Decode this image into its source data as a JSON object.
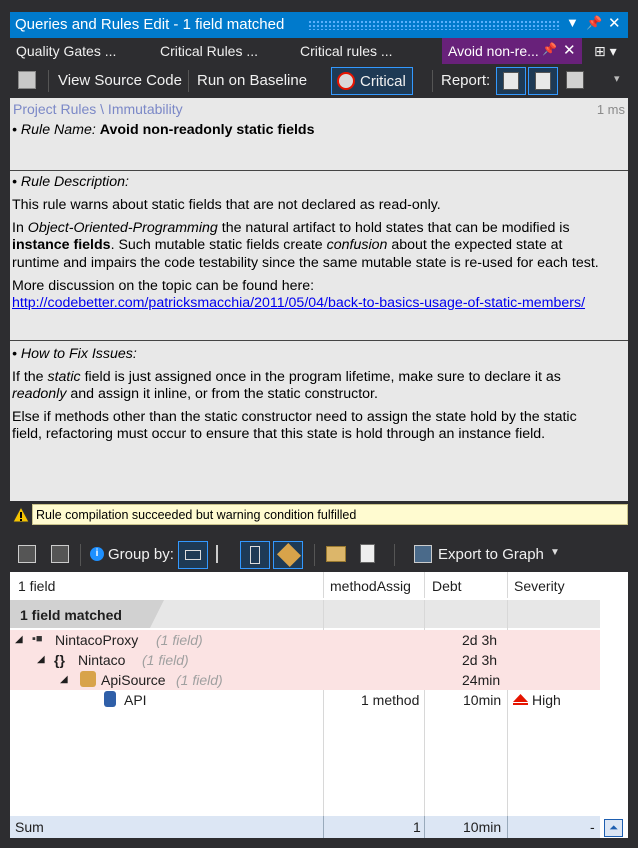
{
  "window": {
    "title": "Queries and Rules Edit  - 1 field matched"
  },
  "tabs": [
    {
      "label": "Quality Gates ..."
    },
    {
      "label": "Critical Rules ..."
    },
    {
      "label": "Critical rules ..."
    },
    {
      "label": "Avoid non-re..."
    }
  ],
  "toolbar": {
    "view_source": "View Source Code",
    "run_baseline": "Run on Baseline",
    "critical": "Critical",
    "report": "Report:"
  },
  "rule": {
    "breadcrumb": "Project Rules \\ Immutability",
    "elapsed": "1 ms",
    "name_label": "• Rule Name:",
    "name": "Avoid non-readonly static fields",
    "desc_label": "• Rule Description:",
    "desc1": "This rule warns about static fields that are not declared as read-only.",
    "desc2a": "In ",
    "desc2b": "Object-Oriented-Programming",
    "desc2c": " the natural artifact to hold states that can be modified is",
    "desc3a": "instance fields",
    "desc3b": ". Such mutable static fields create ",
    "desc3c": "confusion",
    "desc3d": " about the expected state at",
    "desc4": "runtime and impairs the code testability since the same mutable state is re-used for each test.",
    "desc5": "More discussion on the topic can be found here:",
    "link": "http://codebetter.com/patricksmacchia/2011/05/04/back-to-basics-usage-of-static-members/",
    "fix_label": "• How to Fix Issues:",
    "fix1a": "If the ",
    "fix1b": "static",
    "fix1c": " field is just assigned once in the program lifetime, make sure to declare it as",
    "fix2a": "readonly",
    "fix2b": " and assign it inline, or from the static constructor.",
    "fix3": "Else if methods other than the static constructor need to assign the state hold by the static",
    "fix4": "field, refactoring must occur to ensure that this state is hold through an instance field."
  },
  "status": {
    "warning": "Rule compilation succeeded but warning condition fulfilled"
  },
  "results_toolbar": {
    "group_by": "Group by:",
    "export": "Export to Graph"
  },
  "grid": {
    "columns": [
      "1 field",
      "methodAssig",
      "Debt",
      "Severity"
    ],
    "group_label": "1 field matched",
    "rows": [
      {
        "name": "NintacoProxy",
        "count": "(1 field)",
        "method": "",
        "debt": "2d  3h",
        "severity": ""
      },
      {
        "name": "Nintaco",
        "count": "(1 field)",
        "method": "",
        "debt": "2d  3h",
        "severity": ""
      },
      {
        "name": "ApiSource",
        "count": "(1 field)",
        "method": "",
        "debt": "24min",
        "severity": ""
      },
      {
        "name": "API",
        "count": "",
        "method": "1 method",
        "debt": "10min",
        "severity": "High"
      }
    ],
    "sum": {
      "label": "Sum",
      "method": "1",
      "debt": "10min",
      "severity": "-"
    }
  },
  "colors": {
    "accent": "#007acc",
    "active_tab": "#68217a",
    "highlight_row": "#fbe3e3",
    "severity_high": "#e51400"
  }
}
